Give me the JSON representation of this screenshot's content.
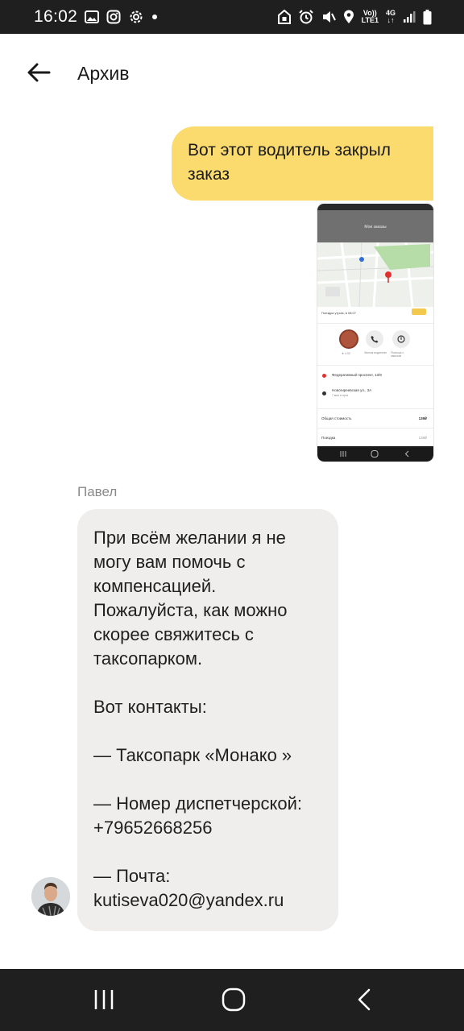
{
  "status_bar": {
    "time": "16:02",
    "volte": "Vo))",
    "lte": "LTE1",
    "network": "4G",
    "icons": [
      "gallery-icon",
      "instagram-icon",
      "settings-icon",
      "dot-icon",
      "battery-saver-icon",
      "alarm-icon",
      "mute-icon",
      "location-icon",
      "signal-icon",
      "battery-icon"
    ]
  },
  "header": {
    "title": "Архив",
    "back_icon": "arrow-left-icon"
  },
  "messages": {
    "outgoing_text": "Вот этот водитель закрыл заказ",
    "attachment": {
      "screen_title": "Мои заказы",
      "trip_label": "Поездка утром, в 08:07",
      "rating": "★ 4.92",
      "call_label": "Звонок водителю",
      "help_label": "Помощь с заказом",
      "address_1": "Федеративный проспект, 13/9",
      "address_2": "Новогиреевская ул., 3А",
      "address_2_sub": "7 мин в пути",
      "total_label": "Общая стоимость",
      "total_value": "139₽",
      "ride_label": "Поездка",
      "ride_value": "139₽"
    },
    "sender_name": "Павел",
    "incoming": {
      "line_1": "При всём желании я не могу вам помочь с компенсацией. Пожалуйста, как можно скорее свяжитесь с таксопарком.",
      "line_2": "Вот контакты:",
      "line_3": "— Таксопарк «Монако »",
      "line_4": "— Номер диспетчерской: +79652668256",
      "line_5": "— Почта: kutiseva020@yandex.ru"
    }
  },
  "nav_bar": {
    "buttons": [
      "recents-icon",
      "home-icon",
      "back-icon"
    ]
  },
  "colors": {
    "outgoing_bubble": "#fbdb6d",
    "incoming_bubble": "#efeeed",
    "system_bar": "#1f1f1f"
  }
}
